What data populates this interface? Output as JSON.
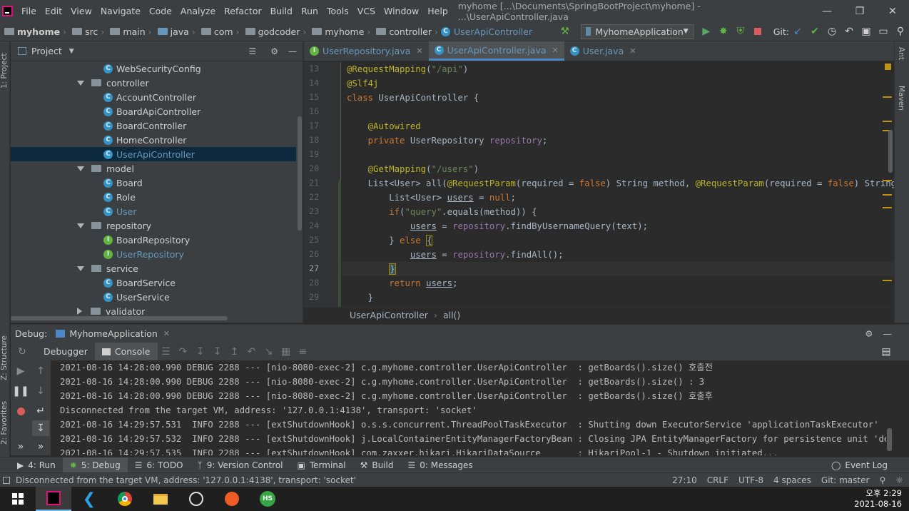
{
  "menubar": {
    "items": [
      "File",
      "Edit",
      "View",
      "Navigate",
      "Code",
      "Analyze",
      "Refactor",
      "Build",
      "Run",
      "Tools",
      "VCS",
      "Window",
      "Help"
    ],
    "title": "myhome [...\\Documents\\SpringBootProject\\myhome] - ...\\UserApiController.java"
  },
  "navbar": {
    "crumbs": [
      "myhome",
      "src",
      "main",
      "java",
      "com",
      "godcoder",
      "myhome",
      "controller",
      "UserApiController"
    ],
    "run_config": "MyhomeApplication",
    "git_label": "Git:"
  },
  "project": {
    "title": "Project",
    "tree": [
      {
        "label": "WebSecurityConfig",
        "kind": "class"
      },
      {
        "label": "controller",
        "kind": "folder"
      },
      {
        "label": "AccountController",
        "kind": "class"
      },
      {
        "label": "BoardApiController",
        "kind": "class"
      },
      {
        "label": "BoardController",
        "kind": "class"
      },
      {
        "label": "HomeController",
        "kind": "class"
      },
      {
        "label": "UserApiController",
        "kind": "class"
      },
      {
        "label": "model",
        "kind": "folder"
      },
      {
        "label": "Board",
        "kind": "class"
      },
      {
        "label": "Role",
        "kind": "class"
      },
      {
        "label": "User",
        "kind": "class"
      },
      {
        "label": "repository",
        "kind": "folder"
      },
      {
        "label": "BoardRepository",
        "kind": "interface"
      },
      {
        "label": "UserRepository",
        "kind": "interface"
      },
      {
        "label": "service",
        "kind": "folder"
      },
      {
        "label": "BoardService",
        "kind": "class"
      },
      {
        "label": "UserService",
        "kind": "class"
      },
      {
        "label": "validator",
        "kind": "folder"
      }
    ]
  },
  "editor": {
    "tabs": [
      "UserRepository.java",
      "UserApiController.java",
      "User.java"
    ],
    "line_numbers": [
      "13",
      "14",
      "15",
      "16",
      "17",
      "18",
      "19",
      "20",
      "21",
      "22",
      "23",
      "24",
      "25",
      "26",
      "27",
      "28",
      "29"
    ],
    "breadcrumb": [
      "UserApiController",
      "all()"
    ]
  },
  "debug": {
    "label": "Debug:",
    "config": "MyhomeApplication",
    "tabs": [
      "Debugger",
      "Console"
    ],
    "log": [
      "2021-08-16 14:28:00.990 DEBUG 2288 --- [nio-8080-exec-2] c.g.myhome.controller.UserApiController  : getBoards().size() 호출전",
      "2021-08-16 14:28:00.990 DEBUG 2288 --- [nio-8080-exec-2] c.g.myhome.controller.UserApiController  : getBoards().size() : 3",
      "2021-08-16 14:28:00.990 DEBUG 2288 --- [nio-8080-exec-2] c.g.myhome.controller.UserApiController  : getBoards().size() 호출후",
      "Disconnected from the target VM, address: '127.0.0.1:4138', transport: 'socket'",
      "2021-08-16 14:29:57.531  INFO 2288 --- [extShutdownHook] o.s.s.concurrent.ThreadPoolTaskExecutor  : Shutting down ExecutorService 'applicationTaskExecutor'",
      "2021-08-16 14:29:57.532  INFO 2288 --- [extShutdownHook] j.LocalContainerEntityManagerFactoryBean : Closing JPA EntityManagerFactory for persistence unit 'default'",
      "2021-08-16 14:29:57.535  INFO 2288 --- [extShutdownHook] com.zaxxer.hikari.HikariDataSource       : HikariPool-1 - Shutdown initiated..."
    ]
  },
  "bottom_tools": [
    "4: Run",
    "5: Debug",
    "6: TODO",
    "9: Version Control",
    "Terminal",
    "Build",
    "0: Messages"
  ],
  "event_log": "Event Log",
  "status": {
    "message": "Disconnected from the target VM, address: '127.0.0.1:4138', transport: 'socket'",
    "position": "27:10",
    "line_sep": "CRLF",
    "encoding": "UTF-8",
    "indent": "4 spaces",
    "git": "Git: master"
  },
  "side_tabs": {
    "project": "1: Project",
    "structure": "Z: Structure",
    "favorites": "2: Favorites",
    "ant": "Ant",
    "maven": "Maven"
  },
  "taskbar": {
    "time": "오후 2:29",
    "date": "2021-08-16"
  }
}
